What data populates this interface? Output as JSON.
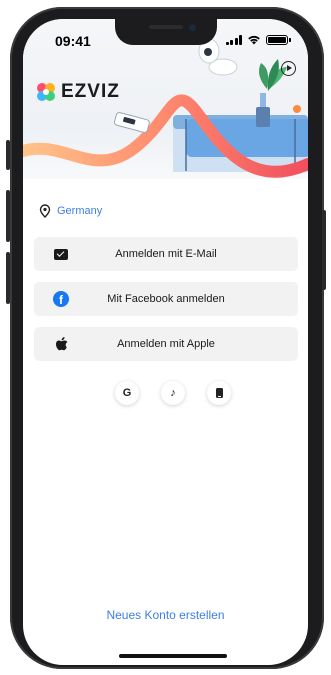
{
  "status_bar": {
    "time": "09:41"
  },
  "brand": {
    "name": "EZVIZ"
  },
  "region": {
    "label": "Germany"
  },
  "login_options": [
    {
      "label": "Anmelden mit E-Mail",
      "icon": "mail-icon"
    },
    {
      "label": "Mit Facebook anmelden",
      "icon": "facebook-icon"
    },
    {
      "label": "Anmelden mit Apple",
      "icon": "apple-icon"
    }
  ],
  "social_login": [
    {
      "icon": "google-icon",
      "glyph": "G"
    },
    {
      "icon": "tiktok-icon",
      "glyph": "♪"
    },
    {
      "icon": "phone-icon",
      "glyph": ""
    }
  ],
  "footer": {
    "create_account": "Neues Konto erstellen"
  },
  "colors": {
    "accent": "#3d7fe6",
    "facebook": "#1877f2",
    "button_bg": "#f2f2f3"
  }
}
